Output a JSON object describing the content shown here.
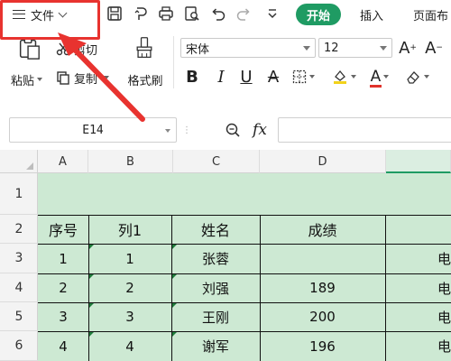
{
  "toolbar": {
    "file_label": "文件",
    "tabs": {
      "start": "开始",
      "insert": "插入",
      "page": "页面布"
    }
  },
  "ribbon": {
    "paste": "粘贴",
    "cut": "剪切",
    "copy": "复制",
    "format_painter": "格式刷",
    "font_name": "宋体",
    "font_size": "12"
  },
  "formula_bar": {
    "cell_ref": "E14",
    "fx": "fx"
  },
  "sheet": {
    "columns": [
      "A",
      "B",
      "C",
      "D"
    ],
    "rows": [
      "1",
      "2",
      "3",
      "4",
      "5",
      "6"
    ],
    "table": {
      "headers": [
        "序号",
        "列1",
        "姓名",
        "成绩"
      ],
      "records": [
        {
          "seq": "1",
          "col1": "1",
          "name": "张蓉",
          "score": "",
          "e": "电"
        },
        {
          "seq": "2",
          "col1": "2",
          "name": "刘强",
          "score": "189",
          "e": "电"
        },
        {
          "seq": "3",
          "col1": "3",
          "name": "王刚",
          "score": "200",
          "e": "电"
        },
        {
          "seq": "4",
          "col1": "4",
          "name": "谢军",
          "score": "196",
          "e": "电"
        }
      ]
    }
  },
  "colors": {
    "accent": "#1f9b63",
    "annotation": "#e8332f",
    "cell_fill": "#cde9d3"
  }
}
